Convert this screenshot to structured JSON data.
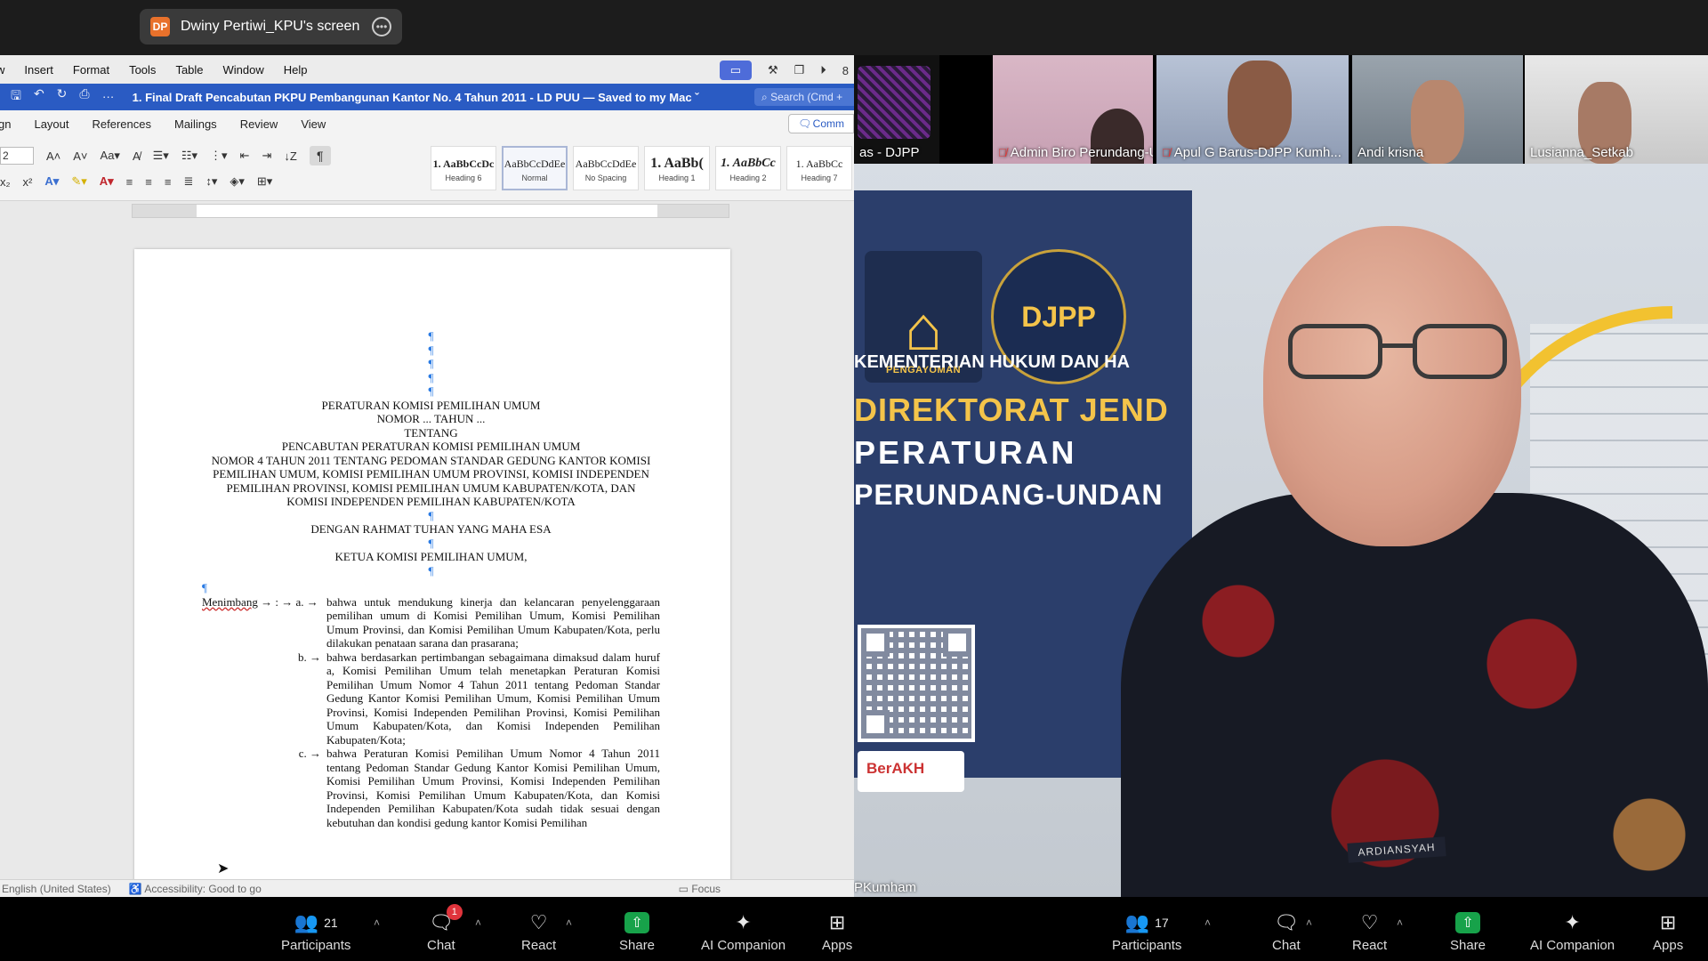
{
  "screen_share": {
    "initials": "DP",
    "label": "Dwiny Pertiwi_KPU's screen"
  },
  "word": {
    "menu": [
      "w",
      "Insert",
      "Format",
      "Tools",
      "Table",
      "Window",
      "Help"
    ],
    "title": "1. Final Draft Pencabutan PKPU Pembangunan Kantor No. 4 Tahun 2011 - LD PUU — Saved to my Mac ˇ",
    "search": "Search (Cmd +",
    "tabs": [
      "gn",
      "Layout",
      "References",
      "Mailings",
      "Review",
      "View"
    ],
    "comments_btn": "Comm",
    "font_size": "2",
    "styles": [
      {
        "sample": "1. AaBbCcDc",
        "name": "Heading 6"
      },
      {
        "sample": "AaBbCcDdEe",
        "name": "Normal"
      },
      {
        "sample": "AaBbCcDdEe",
        "name": "No Spacing"
      },
      {
        "sample": "1. AaBb(",
        "name": "Heading 1"
      },
      {
        "sample": "1. AaBbCc",
        "name": "Heading 2"
      },
      {
        "sample": "1. AaBbCc",
        "name": "Heading 7"
      }
    ],
    "status": {
      "language": "English (United States)",
      "accessibility": "Accessibility: Good to go",
      "focus": "Focus"
    },
    "document": {
      "title_lines": [
        "PERATURAN KOMISI PEMILIHAN UMUM",
        "NOMOR ... TAHUN ...",
        "TENTANG",
        "PENCABUTAN PERATURAN KOMISI PEMILIHAN UMUM",
        "NOMOR 4 TAHUN 2011 TENTANG PEDOMAN STANDAR GEDUNG KANTOR KOMISI PEMILIHAN UMUM, KOMISI PEMILIHAN UMUM PROVINSI, KOMISI INDEPENDEN PEMILIHAN PROVINSI, KOMISI PEMILIHAN UMUM KABUPATEN/KOTA, DAN KOMISI INDEPENDEN PEMILIHAN KABUPATEN/KOTA"
      ],
      "blessing": "DENGAN RAHMAT TUHAN YANG MAHA ESA",
      "chair": "KETUA KOMISI PEMILIHAN UMUM,",
      "consider_label": "Menimbang",
      "clauses": [
        {
          "letter": "a.",
          "text": "bahwa untuk mendukung kinerja dan kelancaran penyelenggaraan pemilihan umum di Komisi Pemilihan Umum, Komisi Pemilihan Umum Provinsi, dan Komisi Pemilihan Umum Kabupaten/Kota, perlu dilakukan penataan sarana dan prasarana;"
        },
        {
          "letter": "b.",
          "text": "bahwa berdasarkan pertimbangan sebagaimana dimaksud dalam huruf a, Komisi Pemilihan Umum telah menetapkan Peraturan Komisi Pemilihan Umum Nomor 4 Tahun 2011 tentang Pedoman Standar Gedung Kantor Komisi Pemilihan Umum, Komisi Pemilihan Umum Provinsi, Komisi Independen Pemilihan Provinsi, Komisi Pemilihan Umum Kabupaten/Kota, dan Komisi Independen Pemilihan Kabupaten/Kota;"
        },
        {
          "letter": "c.",
          "text": "bahwa Peraturan Komisi Pemilihan Umum Nomor 4 Tahun 2011 tentang Pedoman Standar Gedung Kantor Komisi Pemilihan Umum, Komisi Pemilihan Umum Provinsi, Komisi Independen Pemilihan Provinsi, Komisi Pemilihan Umum Kabupaten/Kota, dan Komisi Independen Pemilihan Kabupaten/Kota sudah tidak sesuai dengan kebutuhan dan kondisi gedung kantor Komisi Pemilihan"
        }
      ]
    }
  },
  "participants_strip": [
    {
      "name": "as - DJPP",
      "muted": false
    },
    {
      "name": "Admin Biro Perundang-U...",
      "muted": true
    },
    {
      "name": "Apul G Barus-DJPP Kumh...",
      "muted": true
    },
    {
      "name": "Andi krisna",
      "muted": false
    },
    {
      "name": "Lusianna_Setkab",
      "muted": false
    }
  ],
  "speaker": {
    "name": "PKumham",
    "logo_left_label": "PENGAYOMAN",
    "logo_right_label": "DJPP",
    "ministry": "KEMENTERIAN HUKUM DAN HA",
    "directorate_line1": "DIREKTORAT JEND",
    "directorate_line2": "PERATURAN",
    "directorate_line3": "PERUNDANG-UNDAN",
    "badge": "BerAKH",
    "nametag": "ARDIANSYAH"
  },
  "toolbar_left": {
    "participants_label": "Participants",
    "participants_count": "21",
    "chat_label": "Chat",
    "chat_badge": "1",
    "react_label": "React",
    "share_label": "Share",
    "ai_label": "AI Companion",
    "apps_label": "Apps"
  },
  "toolbar_right": {
    "participants_label": "Participants",
    "participants_count": "17",
    "chat_label": "Chat",
    "react_label": "React",
    "share_label": "Share",
    "ai_label": "AI Companion",
    "apps_label": "Apps"
  }
}
